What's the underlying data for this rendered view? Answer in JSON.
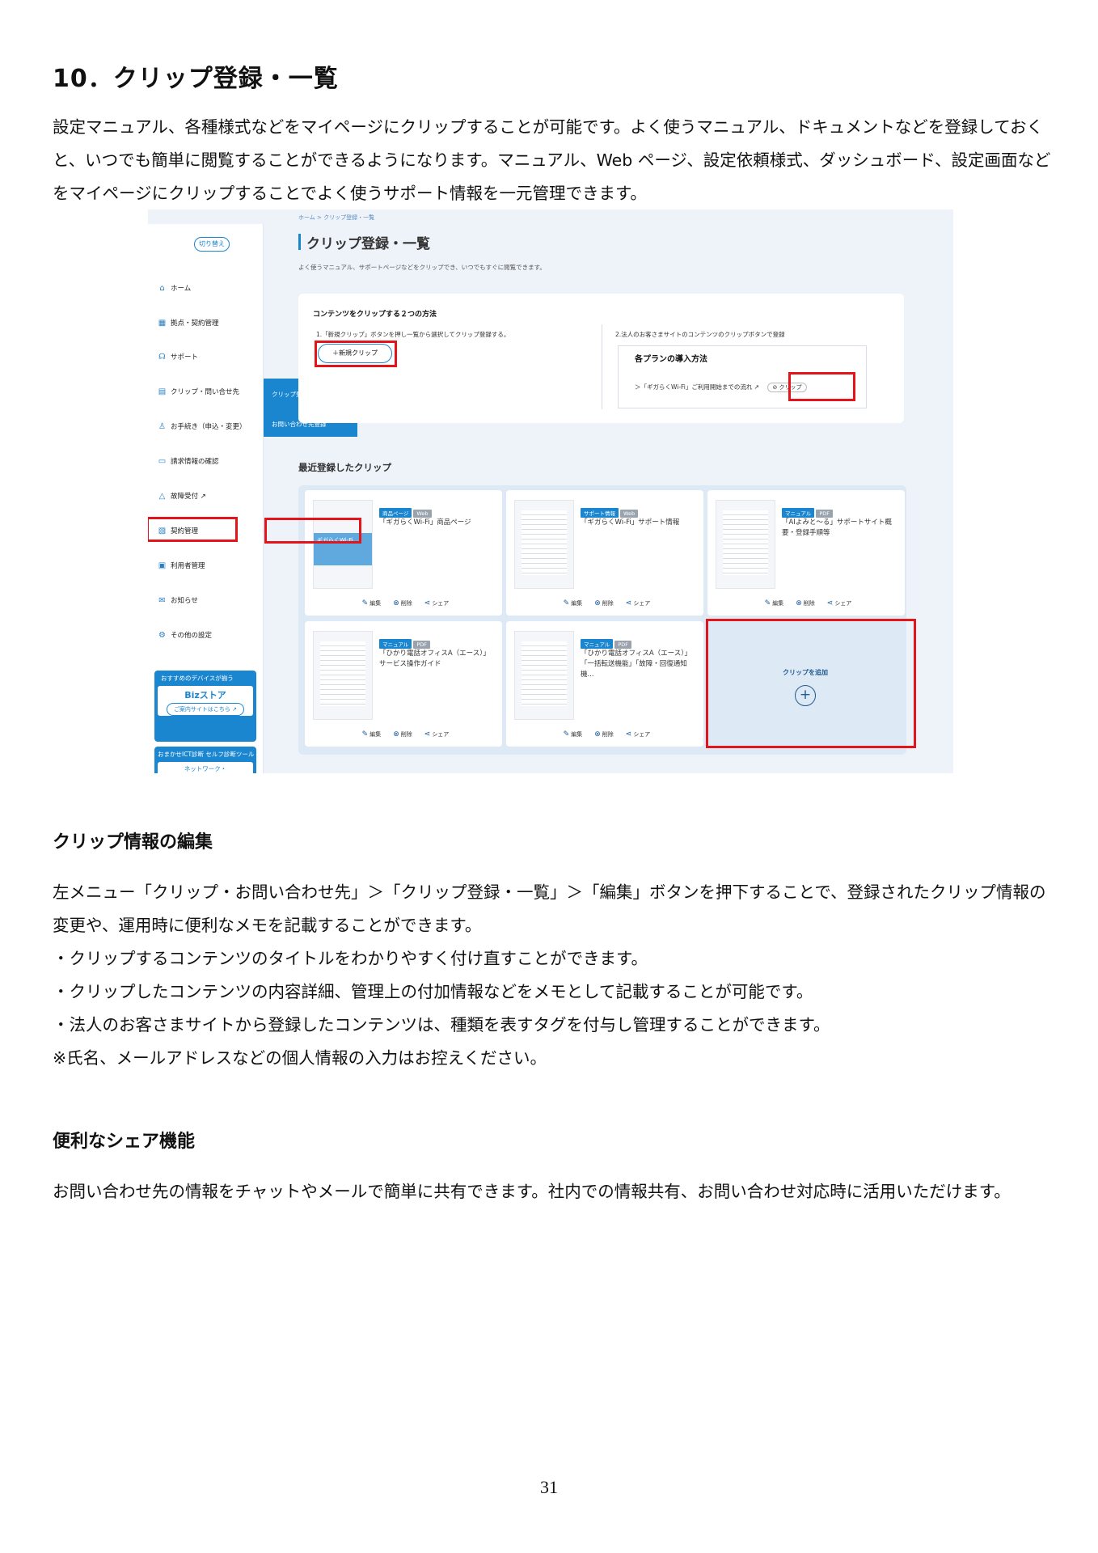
{
  "section_title": "10．クリップ登録・一覧",
  "intro": "設定マニュアル、各種様式などをマイページにクリップすることが可能です。よく使うマニュアル、ドキュメントなどを登録しておくと、いつでも簡単に閲覧することができるようになります。マニュアル、Web ページ、設定依頼様式、ダッシュボード、設定画面などをマイページにクリップすることでよく使うサポート情報を一元管理できます。",
  "screenshot": {
    "breadcrumb": "ホーム > クリップ登録・一覧",
    "switch_button": "切り替え",
    "sidebar_items": [
      {
        "icon": "home-icon",
        "glyph": "⌂",
        "label": "ホーム"
      },
      {
        "icon": "building-icon",
        "glyph": "▦",
        "label": "拠点・契約管理"
      },
      {
        "icon": "headset-icon",
        "glyph": "☊",
        "label": "サポート"
      },
      {
        "icon": "clipboard-icon",
        "glyph": "▤",
        "label": "クリップ・問い合せ先"
      },
      {
        "icon": "person-icon",
        "glyph": "♙",
        "label": "お手続き（申込・変更）"
      },
      {
        "icon": "invoice-icon",
        "glyph": "▭",
        "label": "請求情報の確認"
      },
      {
        "icon": "warning-icon",
        "glyph": "△",
        "label": "故障受付 ↗"
      },
      {
        "icon": "contract-icon",
        "glyph": "▧",
        "label": "契約管理"
      },
      {
        "icon": "user-manage-icon",
        "glyph": "▣",
        "label": "利用者管理"
      },
      {
        "icon": "megaphone-icon",
        "glyph": "✉",
        "label": "お知らせ"
      },
      {
        "icon": "gear-icon",
        "glyph": "⚙",
        "label": "その他の設定"
      }
    ],
    "ad1_header": "おすすめのデバイスが揃う",
    "ad1_brand": "Bizストア",
    "ad1_button": "ご案内サイトはこちら ↗",
    "ad2_header": "おまかせICT診断 セルフ診断ツール",
    "ad2_item": "ネットワーク・",
    "flyout": [
      "クリップ登録・一覧",
      "お問い合わせ先登録"
    ],
    "page_title": "クリップ登録・一覧",
    "page_lead": "よく使うマニュアル、サポートページなどをクリップでき、いつでもすぐに閲覧できます。",
    "how": {
      "title": "コンテンツをクリップする２つの方法",
      "method1": "1.「新規クリップ」ボタンを押し一覧から選択してクリップ登録する。",
      "new_clip_button": "＋新規クリップ",
      "method2": "2.法人のお客さまサイトのコンテンツのクリップボタンで登録",
      "plan_title": "各プランの導入方法",
      "plan_row": "＞「ギガらくWi-Fi」ご利用開始までの流れ ↗",
      "clip_chip": "⊘ クリップ"
    },
    "recent_title": "最近登録したクリップ",
    "cards": [
      {
        "tags": [
          "商品ページ",
          "Web"
        ],
        "title": "「ギガらくWi-Fi」商品ページ",
        "thumb": "ギガらくWi-Fi"
      },
      {
        "tags": [
          "サポート情報",
          "Web"
        ],
        "title": "「ギガらくWi-Fi」サポート情報",
        "thumb": ""
      },
      {
        "tags": [
          "マニュアル",
          "PDF"
        ],
        "title": "「AIよみと～る」サポートサイト概要・登録手順等",
        "thumb": ""
      },
      {
        "tags": [
          "マニュアル",
          "PDF"
        ],
        "title": "「ひかり電話オフィスA（エース）」サービス操作ガイド",
        "thumb": ""
      },
      {
        "tags": [
          "マニュアル",
          "PDF"
        ],
        "title": "「ひかり電話オフィスA（エース）」「一括転送機能」「故障・回復通知機...",
        "thumb": ""
      }
    ],
    "card_actions": {
      "edit": "編集",
      "delete": "削除",
      "share": "シェア"
    },
    "add_clip": "クリップを追加"
  },
  "edit_heading": "クリップ情報の編集",
  "edit_text": "左メニュー「クリップ・お問い合わせ先」＞「クリップ登録・一覧」＞「編集」ボタンを押下することで、登録されたクリップ情報の変更や、運用時に便利なメモを記載することができます。",
  "edit_bullets": [
    "・クリップするコンテンツのタイトルをわかりやすく付け直すことができます。",
    "・クリップしたコンテンツの内容詳細、管理上の付加情報などをメモとして記載することが可能です。",
    "・法人のお客さまサイトから登録したコンテンツは、種類を表すタグを付与し管理することができます。",
    "※氏名、メールアドレスなどの個人情報の入力はお控えください。"
  ],
  "share_heading": "便利なシェア機能",
  "share_text": "お問い合わせ先の情報をチャットやメールで簡単に共有できます。社内での情報共有、お問い合わせ対応時に活用いただけます。",
  "page_number": "31"
}
